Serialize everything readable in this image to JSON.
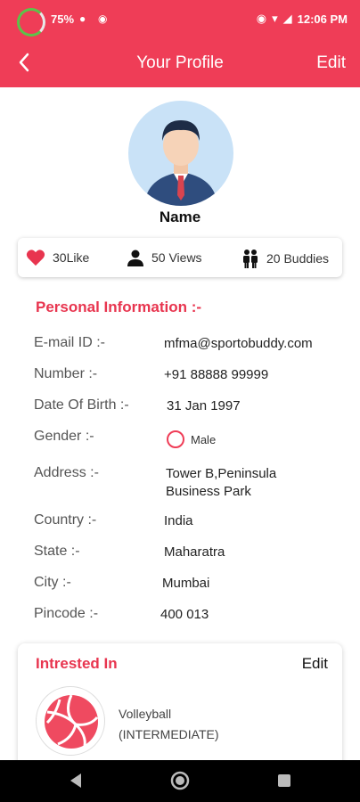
{
  "status_bar": {
    "battery": "75%",
    "time": "12:06 PM"
  },
  "toolbar": {
    "title": "Your Profile",
    "edit_label": "Edit"
  },
  "profile": {
    "name": "Name"
  },
  "stats": {
    "likes": "30Like",
    "views": "50 Views",
    "buddies": "20 Buddies"
  },
  "personal": {
    "section_title": "Personal Information :-",
    "rows": {
      "email": {
        "label": "E-mail ID :-",
        "value": "mfma@sportobuddy.com"
      },
      "number": {
        "label": "Number :-",
        "value": "+91 88888 99999"
      },
      "dob": {
        "label": "Date Of Birth :-",
        "value": "31 Jan 1997"
      },
      "gender": {
        "label": "Gender :-",
        "value": "Male"
      },
      "address": {
        "label": "Address :-",
        "value_line1": "Tower B,Peninsula",
        "value_line2": "Business Park"
      },
      "country": {
        "label": "Country :-",
        "value": "India"
      },
      "state": {
        "label": "State :-",
        "value": "Maharatra"
      },
      "city": {
        "label": "City :-",
        "value": "Mumbai"
      },
      "pincode": {
        "label": "Pincode :-",
        "value": "400 013"
      }
    }
  },
  "interests": {
    "title": "Intrested In",
    "edit_label": "Edit",
    "items": [
      {
        "sport": "Volleyball",
        "level": "(INTERMEDIATE)",
        "icon": "volleyball-icon"
      }
    ]
  },
  "colors": {
    "accent": "#ef3d57",
    "section_title": "#e8354f"
  }
}
